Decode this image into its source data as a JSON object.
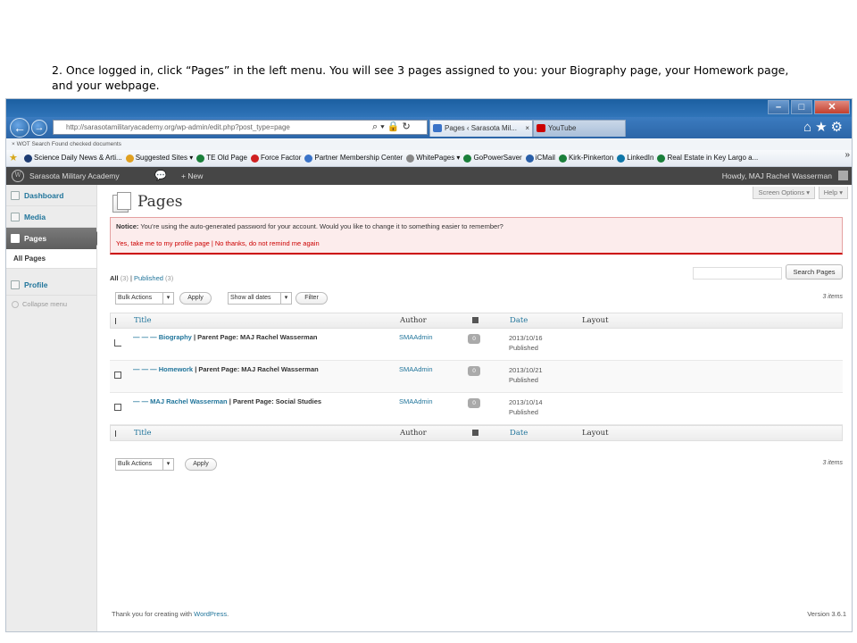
{
  "instruction": {
    "line1": "2. Once logged in, click “Pages” in the left menu. You will see 3 pages assigned to you: your Biography page, your Homework page,",
    "line2": "and your webpage."
  },
  "browser": {
    "address": "http://sarasotamilitaryacademy.org/wp-admin/edit.php?post_type=page",
    "tabs": [
      {
        "label": "Pages ‹ Sarasota Mil...",
        "close": "×"
      },
      {
        "label": "YouTube",
        "close": ""
      }
    ],
    "findbar": "×   WOT Search Found checked documents",
    "favorites": [
      {
        "label": "Science Daily News & Arti...",
        "color": "#1e3c72"
      },
      {
        "label": "Suggested Sites ▾",
        "color": "#e0a020"
      },
      {
        "label": "TE Old Page",
        "color": "#1a7f3a"
      },
      {
        "label": "Force Factor",
        "color": "#d02020"
      },
      {
        "label": "Partner Membership Center",
        "color": "#3a73c8"
      },
      {
        "label": "WhitePages ▾",
        "color": "#888888"
      },
      {
        "label": "GoPowerSaver",
        "color": "#1a7f3a"
      },
      {
        "label": "iCMail",
        "color": "#2a5fa8"
      },
      {
        "label": "Kirk-Pinkerton",
        "color": "#1a7f3a"
      },
      {
        "label": "LinkedIn",
        "color": "#0e76a8"
      },
      {
        "label": "Real Estate in Key Largo a...",
        "color": "#1a7f3a"
      }
    ],
    "more_chevron": "»"
  },
  "adminbar": {
    "site_name": "Sarasota Military Academy",
    "new_label": "+ New",
    "howdy": "Howdy, MAJ Rachel Wasserman"
  },
  "sidebar": {
    "items": [
      {
        "label": "Dashboard"
      },
      {
        "label": "Media"
      },
      {
        "label": "Pages"
      },
      {
        "label": "All Pages"
      },
      {
        "label": "Profile"
      }
    ],
    "collapse": "Collapse menu"
  },
  "content": {
    "screen_options": "Screen Options ▾",
    "help": "Help ▾",
    "title": "Pages",
    "notice_strong": "Notice:",
    "notice_text": " You’re using the auto-generated password for your account. Would you like to change it to something easier to remember?",
    "notice_links": "Yes, take me to my profile page | No thanks, do not remind me again",
    "filter_all": "All",
    "filter_all_count": "(3)",
    "filter_sep": " | ",
    "filter_published": "Published",
    "filter_published_count": "(3)",
    "search_button": "Search Pages",
    "bulk_actions": "Bulk Actions",
    "apply": "Apply",
    "show_all_dates": "Show all dates",
    "filter_button": "Filter",
    "items_count": "3 items",
    "columns": {
      "title": "Title",
      "author": "Author",
      "date": "Date",
      "layout": "Layout"
    },
    "rows": [
      {
        "prefix": "— — — ",
        "name": "Biography",
        "parent": " | Parent Page: MAJ Rachel Wasserman",
        "author": "SMAAdmin",
        "comments": "0",
        "date": "2013/10/16",
        "status": "Published"
      },
      {
        "prefix": "— — — ",
        "name": "Homework",
        "parent": " | Parent Page: MAJ Rachel Wasserman",
        "author": "SMAAdmin",
        "comments": "0",
        "date": "2013/10/21",
        "status": "Published"
      },
      {
        "prefix": "— — ",
        "name": "MAJ Rachel Wasserman",
        "parent": " | Parent Page: Social Studies",
        "author": "SMAAdmin",
        "comments": "0",
        "date": "2013/10/14",
        "status": "Published"
      }
    ],
    "footer_text": "Thank you for creating with ",
    "footer_link": "WordPress",
    "footer_suffix": ".",
    "version": "Version 3.6.1"
  }
}
